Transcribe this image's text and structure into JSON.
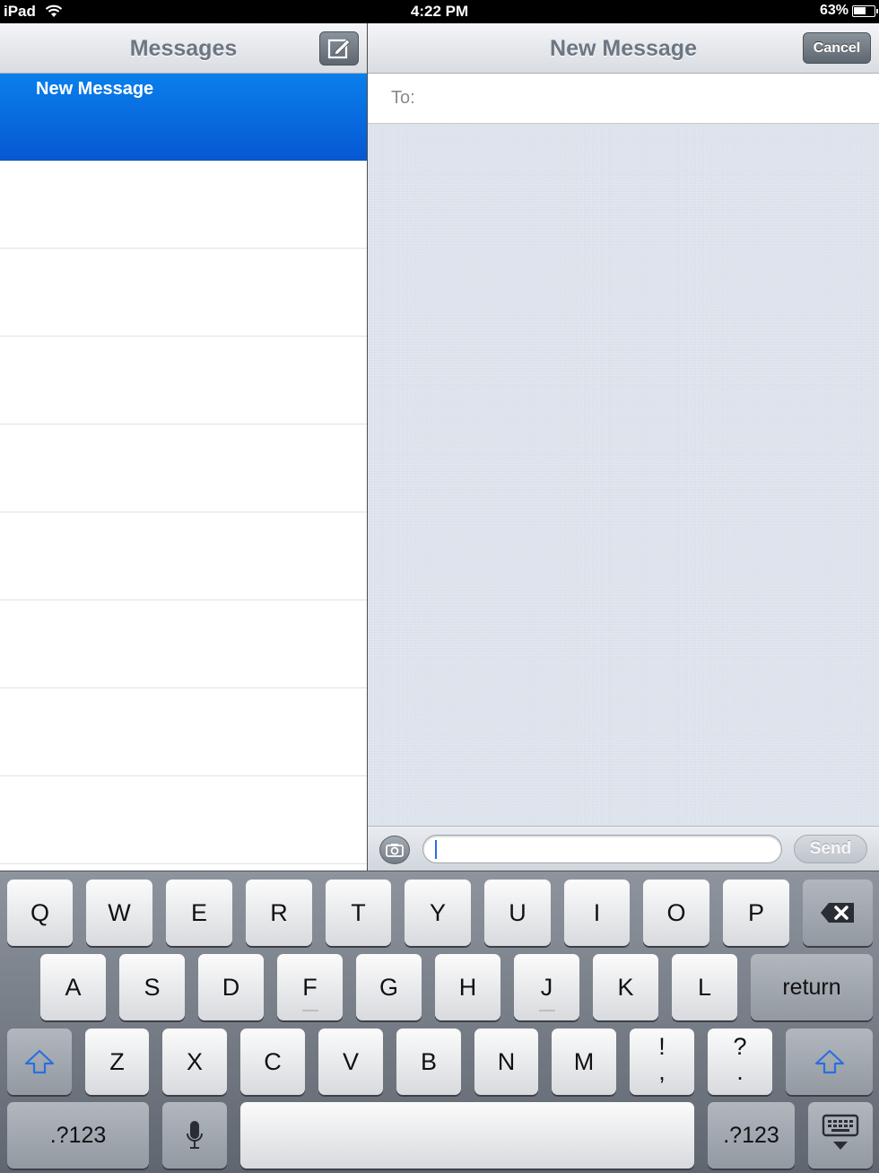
{
  "status_bar": {
    "carrier": "iPad",
    "time": "4:22 PM",
    "battery_percent": "63%",
    "battery_level": 0.63
  },
  "left_pane": {
    "title": "Messages",
    "items": [
      {
        "title": "New Message",
        "selected": true
      }
    ]
  },
  "right_pane": {
    "title": "New Message",
    "cancel_label": "Cancel",
    "to_label": "To:",
    "send_label": "Send"
  },
  "keyboard": {
    "row1": [
      "Q",
      "W",
      "E",
      "R",
      "T",
      "Y",
      "U",
      "I",
      "O",
      "P"
    ],
    "row2": [
      "A",
      "S",
      "D",
      "F",
      "G",
      "H",
      "J",
      "K",
      "L"
    ],
    "return_label": "return",
    "row3": [
      "Z",
      "X",
      "C",
      "V",
      "B",
      "N",
      "M"
    ],
    "punct1_top": "!",
    "punct1_bottom": ",",
    "punct2_top": "?",
    "punct2_bottom": ".",
    "numbers_label": ".?123"
  },
  "colors": {
    "selection_blue": "#0a6fe4",
    "caret_blue": "#2a6fe0"
  }
}
